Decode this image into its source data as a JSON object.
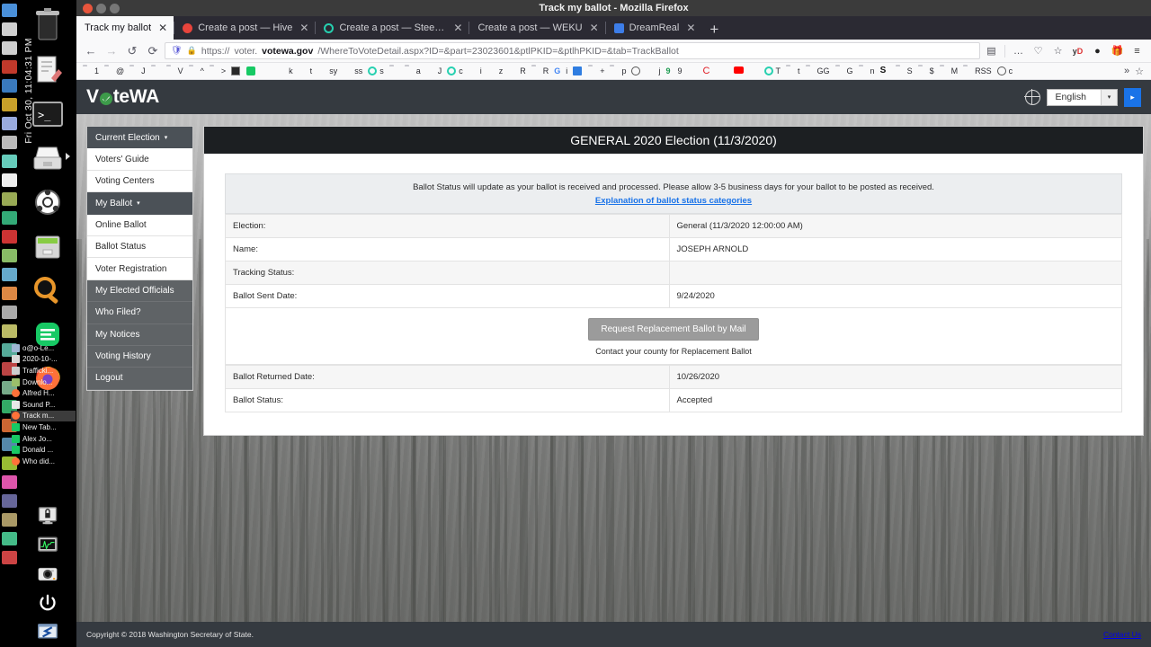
{
  "desktop": {
    "clock": "Fri Oct 30, 11:04:31 PM",
    "dock_icons": [
      {
        "name": "trash-icon"
      },
      {
        "name": "text-editor-icon"
      },
      {
        "name": "terminal-icon"
      },
      {
        "name": "scanner-icon"
      },
      {
        "name": "ubuntu-update-icon"
      },
      {
        "name": "archive-manager-icon"
      },
      {
        "name": "search-icon"
      },
      {
        "name": "notes-icon"
      },
      {
        "name": "firefox-icon"
      }
    ],
    "bottom_icons": [
      {
        "name": "lock-screen-icon"
      },
      {
        "name": "system-monitor-icon"
      },
      {
        "name": "screenshot-camera-icon"
      },
      {
        "name": "power-icon"
      },
      {
        "name": "xkill-icon"
      }
    ],
    "window_list": [
      {
        "label": "o@o-Le...",
        "selected": false
      },
      {
        "label": "2020-10-...",
        "selected": false
      },
      {
        "label": "Trafficki...",
        "selected": false
      },
      {
        "label": "Downlo...",
        "selected": false
      },
      {
        "label": "Alfred H...",
        "selected": false
      },
      {
        "label": "Sound P...",
        "selected": false
      },
      {
        "label": "Track m...",
        "selected": true
      },
      {
        "label": "New Tab...",
        "selected": false
      },
      {
        "label": "Alex Jo...",
        "selected": false
      },
      {
        "label": "Donald ...",
        "selected": false
      },
      {
        "label": "Who did...",
        "selected": false
      }
    ]
  },
  "browser": {
    "window_title": "Track my ballot - Mozilla Firefox",
    "tabs": [
      {
        "label": "Track my ballot",
        "active": true,
        "close": "✕"
      },
      {
        "label": "Create a post — Hive",
        "active": false,
        "close": "✕"
      },
      {
        "label": "Create a post — Steemit",
        "active": false,
        "close": "✕"
      },
      {
        "label": "Create a post — WEKU",
        "active": false,
        "close": "✕"
      },
      {
        "label": "DreamReal",
        "active": false,
        "close": "✕"
      }
    ],
    "new_tab_label": "+",
    "nav": {
      "back": "←",
      "forward": "→",
      "history": "↺",
      "reload": "⟳"
    },
    "url": {
      "scheme": "https://",
      "subdomain": "voter.",
      "host": "votewa.gov",
      "path": "/WhereToVoteDetail.aspx?ID=&part=23023601&ptlPKID=&ptlhPKID=&tab=TrackBallot",
      "full": "https://voter.votewa.gov/WhereToVoteDetail.aspx?ID=&part=23023601&ptlPKID=&ptlhPKID=&tab=TrackBallot"
    },
    "toolbar_right": [
      {
        "name": "reader-mode-icon",
        "glyph": "▤"
      },
      {
        "name": "page-actions-icon",
        "glyph": "…"
      },
      {
        "name": "pocket-icon",
        "glyph": "♡"
      },
      {
        "name": "bookmark-star-icon",
        "glyph": "☆"
      },
      {
        "name": "yandex-extension-icon",
        "glyph": "yD"
      },
      {
        "name": "headphones-extension-icon",
        "glyph": "●"
      },
      {
        "name": "gift-icon",
        "glyph": "☗"
      },
      {
        "name": "menu-icon",
        "glyph": "≡"
      }
    ],
    "bookmarks": [
      {
        "label": "1",
        "icon": "folder"
      },
      {
        "label": "@",
        "icon": "folder"
      },
      {
        "label": "J",
        "icon": "folder"
      },
      {
        "label": "",
        "icon": "folder"
      },
      {
        "label": "V",
        "icon": "folder"
      },
      {
        "label": "^",
        "icon": "folder"
      },
      {
        "label": ">",
        "icon": "folder"
      },
      {
        "label": "",
        "icon": "square-dark"
      },
      {
        "label": "",
        "icon": "green-doc"
      },
      {
        "label": "",
        "icon": "red-hive"
      },
      {
        "label": "k",
        "icon": "blue-f"
      },
      {
        "label": "t",
        "icon": "blue-f"
      },
      {
        "label": "sy",
        "icon": "green-tractor"
      },
      {
        "label": "ss",
        "icon": "red-hive"
      },
      {
        "label": "s",
        "icon": "teal-ring"
      },
      {
        "label": "",
        "icon": "folder"
      },
      {
        "label": "a",
        "icon": "folder"
      },
      {
        "label": "J",
        "icon": "red-hive"
      },
      {
        "label": "c",
        "icon": "teal-ring"
      },
      {
        "label": "i",
        "icon": "red-hive"
      },
      {
        "label": "z",
        "icon": "red-hive"
      },
      {
        "label": "R",
        "icon": "red-hive"
      },
      {
        "label": "R",
        "icon": "folder"
      },
      {
        "label": "i",
        "icon": "google-g"
      },
      {
        "label": "",
        "icon": "blue-translate"
      },
      {
        "label": "+",
        "icon": "folder"
      },
      {
        "label": "p",
        "icon": "folder"
      },
      {
        "label": "",
        "icon": "grey-globe"
      },
      {
        "label": "j",
        "icon": "blue-f"
      },
      {
        "label": "9",
        "icon": "green-9"
      },
      {
        "label": "",
        "icon": "yellow-bulb"
      },
      {
        "label": "",
        "icon": "red-c"
      },
      {
        "label": "",
        "icon": "dark-circle"
      },
      {
        "label": "",
        "icon": "youtube"
      },
      {
        "label": "",
        "icon": "twitter"
      },
      {
        "label": "T",
        "icon": "teal-ring"
      },
      {
        "label": "t",
        "icon": "folder"
      },
      {
        "label": "GG",
        "icon": "folder"
      },
      {
        "label": "G",
        "icon": "folder"
      },
      {
        "label": "n",
        "icon": "folder"
      },
      {
        "label": "",
        "icon": "dark-s"
      },
      {
        "label": "S",
        "icon": "folder"
      },
      {
        "label": "$",
        "icon": "folder"
      },
      {
        "label": "M",
        "icon": "folder"
      },
      {
        "label": "RSS",
        "icon": "folder"
      },
      {
        "label": "c",
        "icon": "grey-globe"
      }
    ],
    "bookmarks_overflow": "»",
    "bookmarks_manage": "☆"
  },
  "site": {
    "logo": {
      "pre": "V",
      "post": "teWA"
    },
    "language": {
      "value": "English",
      "caret": "▾",
      "go": "▸"
    },
    "sidebar": [
      {
        "label": "Current Election",
        "style": "dark",
        "caret": "▾"
      },
      {
        "label": "Voters' Guide",
        "style": "light",
        "caret": ""
      },
      {
        "label": "Voting Centers",
        "style": "light",
        "caret": ""
      },
      {
        "label": "My Ballot",
        "style": "dark",
        "caret": "▾"
      },
      {
        "label": "Online Ballot",
        "style": "light",
        "caret": ""
      },
      {
        "label": "Ballot Status",
        "style": "light",
        "caret": ""
      },
      {
        "label": "Voter Registration",
        "style": "light",
        "caret": ""
      },
      {
        "label": "My Elected Officials",
        "style": "trans",
        "caret": ""
      },
      {
        "label": "Who Filed?",
        "style": "trans",
        "caret": ""
      },
      {
        "label": "My Notices",
        "style": "trans",
        "caret": ""
      },
      {
        "label": "Voting History",
        "style": "trans",
        "caret": ""
      },
      {
        "label": "Logout",
        "style": "trans",
        "caret": ""
      }
    ],
    "content": {
      "title": "GENERAL 2020 Election (11/3/2020)",
      "notice_text": "Ballot Status will update as your ballot is received and processed. Please allow 3-5 business days for your ballot to be posted as received.",
      "notice_link": "Explanation of ballot status categories",
      "rows_top": [
        {
          "key": "Election:",
          "value": "General (11/3/2020 12:00:00 AM)"
        },
        {
          "key": "Name:",
          "value": "JOSEPH ARNOLD"
        },
        {
          "key": "Tracking Status:",
          "value": ""
        },
        {
          "key": "Ballot Sent Date:",
          "value": "9/24/2020"
        }
      ],
      "replacement_button": "Request Replacement Ballot by Mail",
      "replacement_sub": "Contact your county for Replacement Ballot",
      "rows_bottom": [
        {
          "key": "Ballot Returned Date:",
          "value": "10/26/2020"
        },
        {
          "key": "Ballot Status:",
          "value": "Accepted"
        }
      ]
    },
    "footer": {
      "copyright": "Copyright © 2018 Washington Secretary of State.",
      "contact": "Contact Us"
    },
    "colors": {
      "header_bg": "#353a40",
      "title_bg": "#1c1f22",
      "link": "#1a73e8",
      "accent_green": "#3d9b4a"
    }
  }
}
